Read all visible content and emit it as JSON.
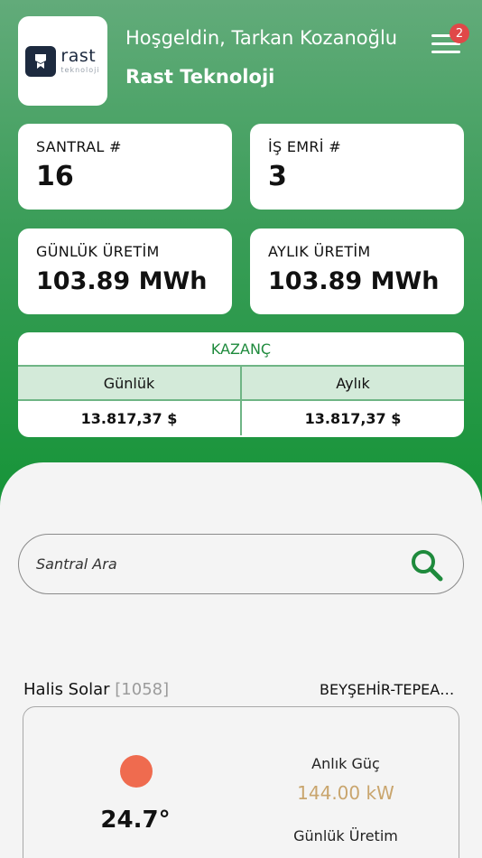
{
  "header": {
    "logo": {
      "brand": "rast",
      "sub": "teknoloji"
    },
    "welcome": "Hoşgeldin, Tarkan Kozanoğlu",
    "company": "Rast Teknoloji",
    "menu_icon": "hamburger-menu-icon",
    "notification_count": "2"
  },
  "stats": {
    "santral": {
      "label": "SANTRAL #",
      "value": "16"
    },
    "is_emri": {
      "label": "İŞ EMRİ #",
      "value": "3"
    },
    "gunluk_uretim": {
      "label": "GÜNLÜK ÜRETİM",
      "value": "103.89 MWh"
    },
    "aylik_uretim": {
      "label": "AYLIK ÜRETİM",
      "value": "103.89 MWh"
    }
  },
  "kazanc": {
    "title": "KAZANÇ",
    "columns": [
      "Günlük",
      "Aylık"
    ],
    "values": [
      "13.817,37 $",
      "13.817,37 $"
    ]
  },
  "search": {
    "placeholder": "Santral Ara",
    "icon": "search-icon"
  },
  "plant": {
    "name": "Halis Solar",
    "id": "[1058]",
    "location": "BEYŞEHİR-TEPEARASI",
    "temperature": "24.7°",
    "instant_power_label": "Anlık Güç",
    "instant_power_value": "144.00 kW",
    "daily_production_label": "Günlük Üretim"
  },
  "colors": {
    "brand_green": "#169438",
    "accent_gold": "#c9a56d",
    "sun": "#ef6b4f",
    "badge": "#e04848"
  }
}
